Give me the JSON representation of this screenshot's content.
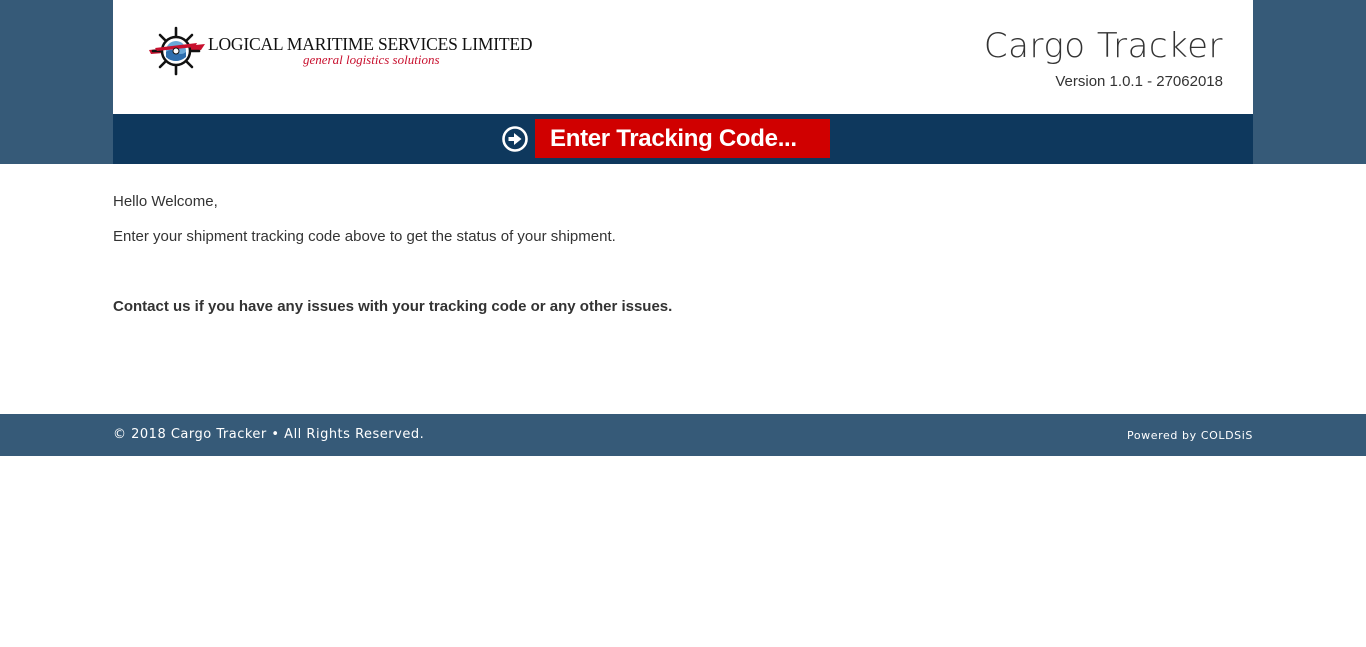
{
  "header": {
    "logo": {
      "company_name": "LOGICAL MARITIME SERVICES LIMITED",
      "tagline": "general logistics solutions",
      "emblem_icon": "ship-wheel-icon"
    },
    "app_title": "Cargo Tracker",
    "version": "Version 1.0.1 - 27062018"
  },
  "tracking": {
    "go_icon": "arrow-circle-right-icon",
    "placeholder": "Enter Tracking Code...",
    "value": ""
  },
  "content": {
    "greeting": "Hello Welcome,",
    "instruction": "Enter your shipment tracking code above to get the status of your shipment.",
    "contact": "Contact us if you have any issues with your tracking code or any other issues."
  },
  "footer": {
    "copyright": "© 2018 Cargo Tracker • All Rights Reserved.",
    "powered_by": "Powered by COLDSiS"
  },
  "colors": {
    "band": "#365a78",
    "tracking_bar": "#0e385d",
    "tracking_input": "#d00000",
    "tagline": "#c8102e"
  }
}
